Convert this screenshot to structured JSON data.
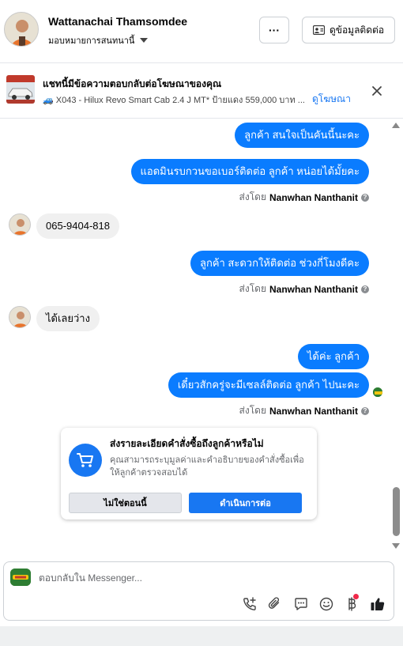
{
  "header": {
    "name": "Wattanachai Thamsomdee",
    "assign_label": "มอบหมายการสนทนานี้",
    "more_label": "···",
    "profile_button_label": "ดูข้อมูลติดต่อ"
  },
  "ad": {
    "title": "แชทนี้มีข้อความตอบกลับต่อโฆษณาของคุณ",
    "subtitle": "🚙 X043 - Hilux Revo Smart Cab 2.4 J MT* ป้ายแดง 559,000 บาท ...",
    "link_label": "ดูโฆษณา"
  },
  "messages": {
    "m1": "ลูกค้า สนใจเป็นคันนี้นะคะ",
    "m2": "แอดมินรบกวนขอเบอร์ติดต่อ ลูกค้า หน่อยได้มั้ยคะ",
    "sent1_prefix": "ส่งโดย",
    "sent1_name": "Nanwhan Nanthanit",
    "m3": "065-9404-818",
    "m4": "ลูกค้า สะดวกให้ติดต่อ ช่วงกี่โมงดีคะ",
    "sent2_prefix": "ส่งโดย",
    "sent2_name": "Nanwhan Nanthanit",
    "m5": "ได้เลยว่าง",
    "m6": "ได้ค่ะ  ลูกค้า",
    "m7": "เดี๋ยวสักครู่จะมีเซลล์ติดต่อ ลูกค้า  ไปนะคะ",
    "sent3_prefix": "ส่งโดย",
    "sent3_name": "Nanwhan Nanthanit"
  },
  "order_card": {
    "title": "ส่งรายละเอียดคำสั่งซื้อถึงลูกค้าหรือไม่",
    "description": "คุณสามารถระบุมูลค่าและคำอธิบายของคำสั่งซื้อเพื่อให้ลูกค้าตรวจสอบได้",
    "no_label": "ไม่ใช่ตอนนี้",
    "yes_label": "ดำเนินการต่อ"
  },
  "composer": {
    "placeholder": "ตอบกลับใน Messenger..."
  },
  "colors": {
    "accent": "#1877f2",
    "outgoing_bubble": "#0a7cff",
    "incoming_bubble": "#f0f0f0"
  },
  "icons": [
    "more-icon",
    "contact-card-icon",
    "close-icon",
    "cart-icon",
    "call-add-icon",
    "attach-icon",
    "chat-icon",
    "emoji-icon",
    "baht-icon",
    "like-icon"
  ]
}
